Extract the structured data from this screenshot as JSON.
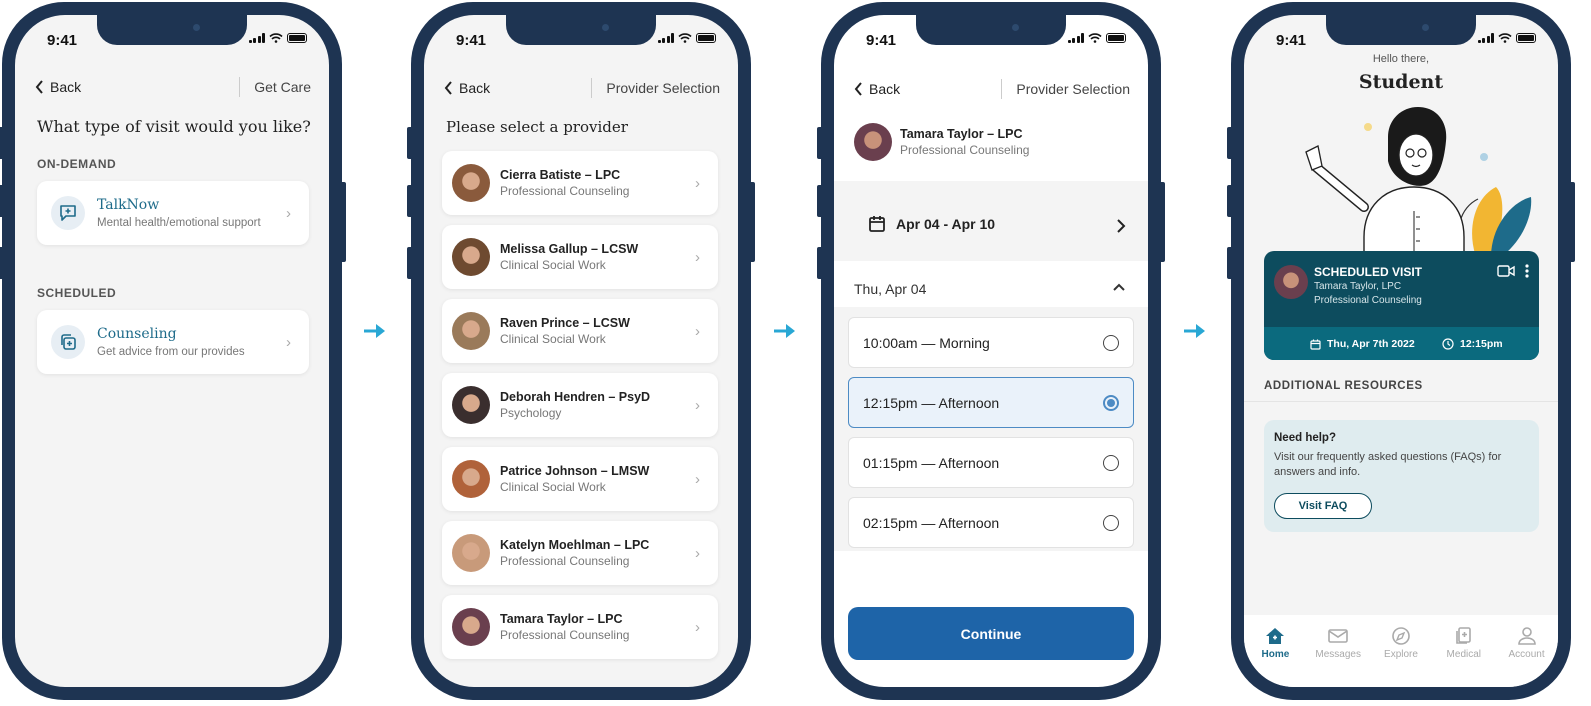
{
  "status_time": "9:41",
  "screens": {
    "visit_type": {
      "back": "Back",
      "nav_title": "Get Care",
      "question": "What type of visit would you like?",
      "ondemand_label": "ON-DEMAND",
      "talknow_title": "TalkNow",
      "talknow_sub": "Mental health/emotional support",
      "scheduled_label": "SCHEDULED",
      "counseling_title": "Counseling",
      "counseling_sub": "Get advice from our provides"
    },
    "provider_list": {
      "back": "Back",
      "nav_title": "Provider Selection",
      "heading": "Please select a provider",
      "providers": [
        {
          "name": "Cierra Batiste – LPC",
          "specialty": "Professional Counseling",
          "color": "#8a5a3c"
        },
        {
          "name": "Melissa Gallup – LCSW",
          "specialty": "Clinical Social Work",
          "color": "#6e4a30"
        },
        {
          "name": "Raven Prince – LCSW",
          "specialty": "Clinical Social Work",
          "color": "#9a7a5a"
        },
        {
          "name": "Deborah Hendren – PsyD",
          "specialty": "Psychology",
          "color": "#3a2e2e"
        },
        {
          "name": "Patrice Johnson – LMSW",
          "specialty": "Clinical Social Work",
          "color": "#b0623a"
        },
        {
          "name": "Katelyn Moehlman – LPC",
          "specialty": "Professional Counseling",
          "color": "#c89a7a"
        },
        {
          "name": "Tamara Taylor – LPC",
          "specialty": "Professional Counseling",
          "color": "#6a3f4e"
        }
      ]
    },
    "schedule": {
      "back": "Back",
      "nav_title": "Provider Selection",
      "provider_name": "Tamara Taylor – LPC",
      "provider_specialty": "Professional Counseling",
      "week_range": "Apr 04 - Apr 10",
      "day_label": "Thu, Apr 04",
      "slots": [
        {
          "label": "10:00am — Morning",
          "selected": false
        },
        {
          "label": "12:15pm — Afternoon",
          "selected": true
        },
        {
          "label": "01:15pm — Afternoon",
          "selected": false
        },
        {
          "label": "02:15pm — Afternoon",
          "selected": false
        }
      ],
      "continue": "Continue"
    },
    "home": {
      "greeting": "Hello there,",
      "name": "Student",
      "visit_title": "SCHEDULED VISIT",
      "visit_provider": "Tamara Taylor, LPC",
      "visit_specialty": "Professional Counseling",
      "visit_date": "Thu, Apr 7th 2022",
      "visit_time": "12:15pm",
      "resources_label": "ADDITIONAL RESOURCES",
      "help_title": "Need help?",
      "help_text": "Visit our frequently asked questions (FAQs) for answers and info.",
      "faq_button": "Visit FAQ",
      "tabs": [
        "Home",
        "Messages",
        "Explore",
        "Medical",
        "Account"
      ]
    }
  },
  "colors": {
    "frame": "#1e3452",
    "accent": "#1e64a8",
    "teal": "#1e6b8a",
    "visit_card": "#0d4c5e",
    "arrow": "#29a7d4"
  }
}
